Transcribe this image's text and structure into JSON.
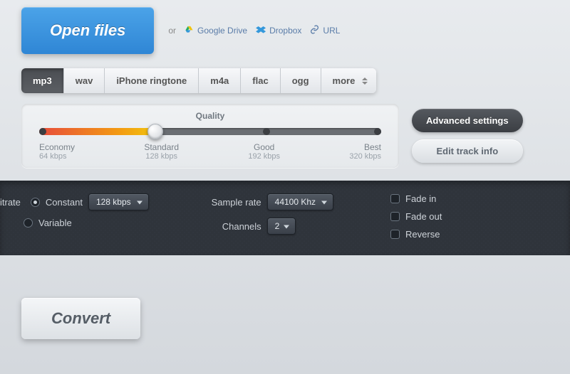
{
  "header": {
    "open_files_label": "Open files",
    "or_label": "or",
    "google_drive_label": "Google Drive",
    "dropbox_label": "Dropbox",
    "url_label": "URL"
  },
  "formats": {
    "items": [
      "mp3",
      "wav",
      "iPhone ringtone",
      "m4a",
      "flac",
      "ogg",
      "more"
    ],
    "active_index": 0
  },
  "quality": {
    "title": "Quality",
    "stops": [
      {
        "name": "Economy",
        "rate": "64 kbps"
      },
      {
        "name": "Standard",
        "rate": "128 kbps"
      },
      {
        "name": "Good",
        "rate": "192 kbps"
      },
      {
        "name": "Best",
        "rate": "320 kbps"
      }
    ],
    "selected_index": 1
  },
  "side": {
    "advanced_label": "Advanced settings",
    "edit_label": "Edit track info"
  },
  "advanced": {
    "bitrate_label": "itrate",
    "constant_label": "Constant",
    "variable_label": "Variable",
    "bitrate_mode": "constant",
    "bitrate_value": "128 kbps",
    "sample_rate_label": "Sample rate",
    "sample_rate_value": "44100 Khz",
    "channels_label": "Channels",
    "channels_value": "2",
    "fade_in_label": "Fade in",
    "fade_out_label": "Fade out",
    "reverse_label": "Reverse",
    "fade_in": false,
    "fade_out": false,
    "reverse": false
  },
  "footer": {
    "convert_label": "Convert"
  }
}
